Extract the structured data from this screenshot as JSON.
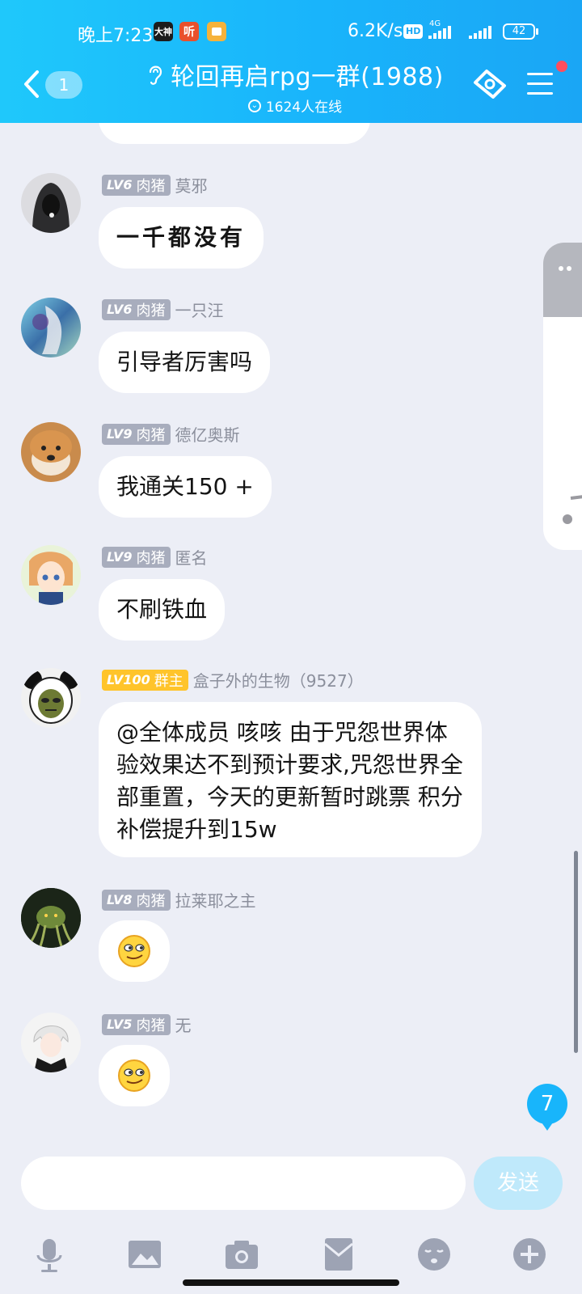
{
  "status_bar": {
    "time": "晚上7:23",
    "app_badges": [
      "大神",
      "听",
      ""
    ],
    "net_speed": "6.2K/s",
    "hd": "HD",
    "network": "4G",
    "battery": "42"
  },
  "header": {
    "back_count": "1",
    "title": "轮回再启rpg一群(1988)",
    "online": "1624人在线"
  },
  "messages": [
    {
      "level": "LV6",
      "role": "肉猪",
      "name": "莫邪",
      "text": "一千都没有",
      "avatar": "hooded-figure"
    },
    {
      "level": "LV6",
      "role": "肉猪",
      "name": "一只汪",
      "text": "引导者厉害吗",
      "avatar": "anime-blue"
    },
    {
      "level": "LV9",
      "role": "肉猪",
      "name": "德亿奥斯",
      "text": "我通关150 +",
      "avatar": "shiba-dog"
    },
    {
      "level": "LV9",
      "role": "肉猪",
      "name": "匿名",
      "text": "不刷铁血",
      "avatar": "anime-girl"
    },
    {
      "level": "LV100",
      "role": "群主",
      "name": "盒子外的生物（9527）",
      "text": "@全体成员 咳咳  由于咒怨世界体验效果达不到预计要求,咒怨世界全部重置，今天的更新暂时跳票 积分补偿提升到15w",
      "avatar": "panda-meme"
    },
    {
      "level": "LV8",
      "role": "肉猪",
      "name": "拉莱耶之主",
      "text": "",
      "emoji": "smirk-emoji",
      "avatar": "cthulhu"
    },
    {
      "level": "LV5",
      "role": "肉猪",
      "name": "无",
      "text": "",
      "emoji": "smirk-emoji",
      "avatar": "white-hair"
    }
  ],
  "new_message_count": "7",
  "input": {
    "placeholder": "",
    "send_label": "发送"
  },
  "toolbar": [
    "microphone-icon",
    "image-icon",
    "camera-icon",
    "red-packet-icon",
    "emoji-icon",
    "plus-icon"
  ],
  "colors": {
    "header_start": "#1fc8fb",
    "header_end": "#1aa6f5",
    "owner_badge": "#ffc42b",
    "level_badge": "#a8adbd",
    "send_disabled": "#bfe9fb"
  }
}
